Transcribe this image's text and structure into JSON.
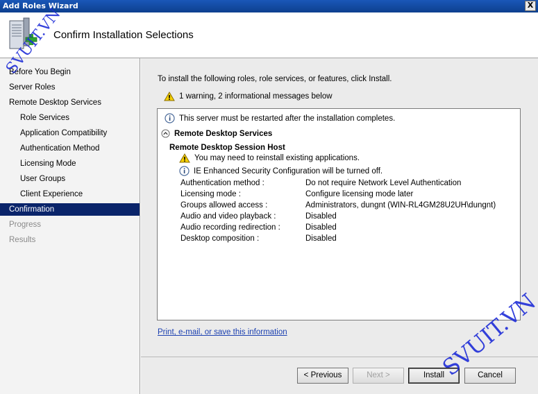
{
  "window": {
    "title": "Add Roles Wizard",
    "close_glyph": "X"
  },
  "header": {
    "title": "Confirm Installation Selections"
  },
  "sidebar": {
    "items": [
      {
        "label": "Before You Begin",
        "state": "normal"
      },
      {
        "label": "Server Roles",
        "state": "normal"
      },
      {
        "label": "Remote Desktop Services",
        "state": "normal"
      },
      {
        "label": "Role Services",
        "state": "normal"
      },
      {
        "label": "Application Compatibility",
        "state": "normal"
      },
      {
        "label": "Authentication Method",
        "state": "normal"
      },
      {
        "label": "Licensing Mode",
        "state": "normal"
      },
      {
        "label": "User Groups",
        "state": "normal"
      },
      {
        "label": "Client Experience",
        "state": "normal"
      },
      {
        "label": "Confirmation",
        "state": "selected"
      },
      {
        "label": "Progress",
        "state": "disabled"
      },
      {
        "label": "Results",
        "state": "disabled"
      }
    ]
  },
  "main": {
    "intro": "To install the following roles, role services, or features, click Install.",
    "summary": "1 warning, 2 informational messages below",
    "panel": {
      "restart_note": "This server must be restarted after the installation completes.",
      "section_title": "Remote Desktop Services",
      "subsection_title": "Remote Desktop Session Host",
      "warning_msg": "You may need to reinstall existing applications.",
      "info_msg": "IE Enhanced Security Configuration will be turned off.",
      "settings": [
        {
          "key": "Authentication method :",
          "value": "Do not require Network Level Authentication"
        },
        {
          "key": "Licensing mode :",
          "value": "Configure licensing mode later"
        },
        {
          "key": "Groups allowed access :",
          "value": "Administrators, dungnt (WIN-RL4GM28U2UH\\dungnt)"
        },
        {
          "key": "Audio and video playback :",
          "value": "Disabled"
        },
        {
          "key": "Audio recording redirection :",
          "value": "Disabled"
        },
        {
          "key": "Desktop composition :",
          "value": "Disabled"
        }
      ]
    },
    "link": "Print, e-mail, or save this information"
  },
  "buttons": {
    "previous": "< Previous",
    "next": "Next >",
    "install": "Install",
    "cancel": "Cancel"
  },
  "watermark": {
    "text": "SVUIT.VN",
    "color": "#1f2dd8"
  },
  "colors": {
    "selection": "#0a246a",
    "titlebar": "#1a57b8",
    "link": "#1a3fb0"
  }
}
